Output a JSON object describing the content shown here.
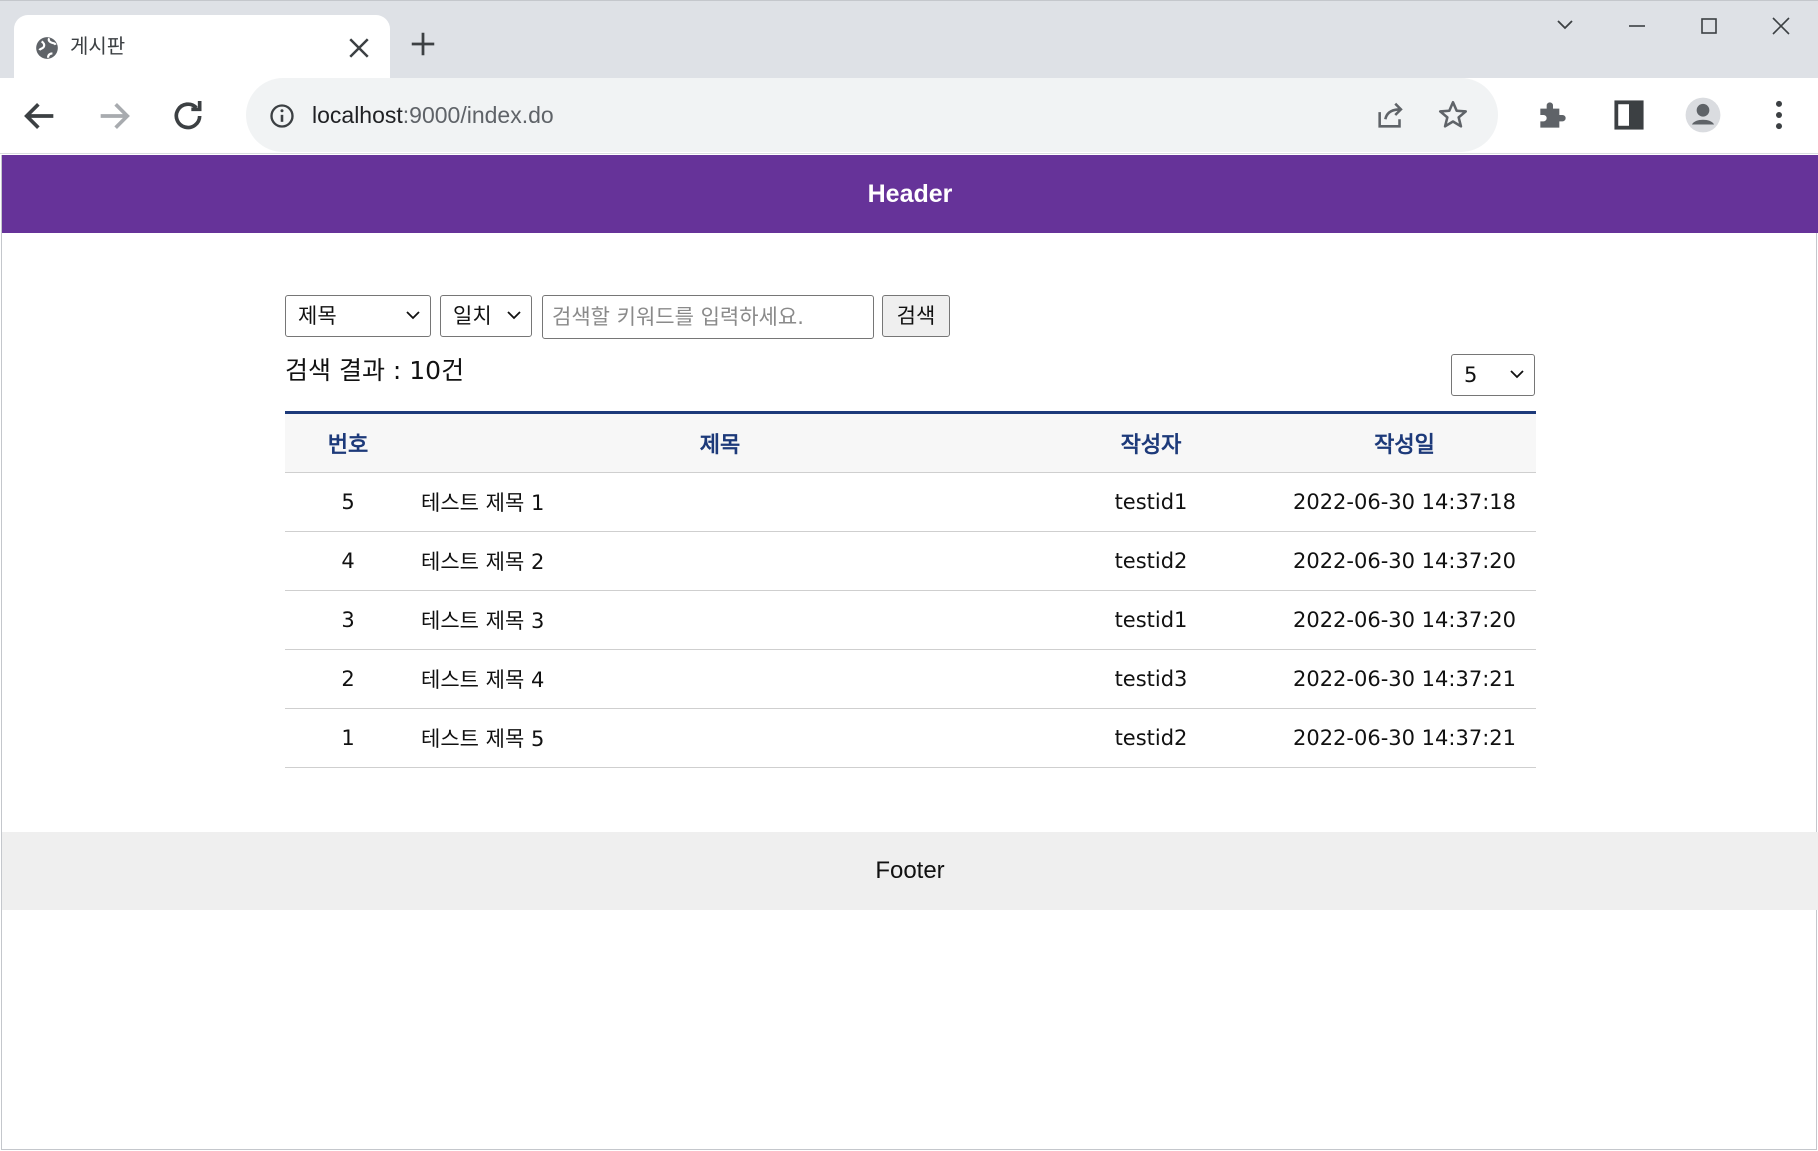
{
  "browser": {
    "tab_title": "게시판",
    "url_host": "localhost",
    "url_rest": ":9000/index.do"
  },
  "header": {
    "title": "Header"
  },
  "search": {
    "field_option": "제목",
    "match_option": "일치",
    "keyword_placeholder": "검색할 키워드를 입력하세요.",
    "button_label": "검색"
  },
  "result": {
    "label": "검색 결과 : 10건"
  },
  "page_size": {
    "selected": "5"
  },
  "table": {
    "headers": [
      "번호",
      "제목",
      "작성자",
      "작성일"
    ],
    "rows": [
      {
        "num": "5",
        "title": "테스트 제목 1",
        "writer": "testid1",
        "date": "2022-06-30 14:37:18"
      },
      {
        "num": "4",
        "title": "테스트 제목 2",
        "writer": "testid2",
        "date": "2022-06-30 14:37:20"
      },
      {
        "num": "3",
        "title": "테스트 제목 3",
        "writer": "testid1",
        "date": "2022-06-30 14:37:20"
      },
      {
        "num": "2",
        "title": "테스트 제목 4",
        "writer": "testid3",
        "date": "2022-06-30 14:37:21"
      },
      {
        "num": "1",
        "title": "테스트 제목 5",
        "writer": "testid2",
        "date": "2022-06-30 14:37:21"
      }
    ]
  },
  "footer": {
    "label": "Footer"
  },
  "colors": {
    "header_bg": "#663399",
    "table_accent": "#1d3a7a",
    "footer_bg": "#efefef"
  }
}
